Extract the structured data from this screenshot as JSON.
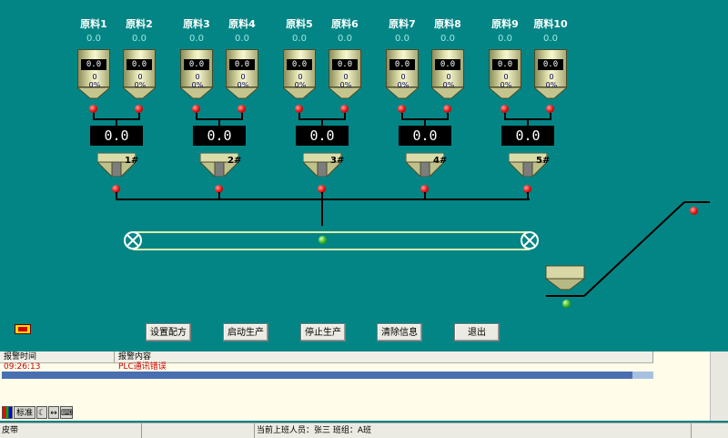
{
  "materials": [
    {
      "name": "原料1",
      "value": "0.0",
      "display": "0.0",
      "count": "0",
      "percent": "0%"
    },
    {
      "name": "原料2",
      "value": "0.0",
      "display": "0.0",
      "count": "0",
      "percent": "0%"
    },
    {
      "name": "原料3",
      "value": "0.0",
      "display": "0.0",
      "count": "0",
      "percent": "0%"
    },
    {
      "name": "原料4",
      "value": "0.0",
      "display": "0.0",
      "count": "0",
      "percent": "0%"
    },
    {
      "name": "原料5",
      "value": "0.0",
      "display": "0.0",
      "count": "0",
      "percent": "0%"
    },
    {
      "name": "原料6",
      "value": "0.0",
      "display": "0.0",
      "count": "0",
      "percent": "0%"
    },
    {
      "name": "原料7",
      "value": "0.0",
      "display": "0.0",
      "count": "0",
      "percent": "0%"
    },
    {
      "name": "原料8",
      "value": "0.0",
      "display": "0.0",
      "count": "0",
      "percent": "0%"
    },
    {
      "name": "原料9",
      "value": "0.0",
      "display": "0.0",
      "count": "0",
      "percent": "0%"
    },
    {
      "name": "原料10",
      "value": "0.0",
      "display": "0.0",
      "count": "0",
      "percent": "0%"
    }
  ],
  "scales": [
    {
      "value": "0.0",
      "label": "1#"
    },
    {
      "value": "0.0",
      "label": "2#"
    },
    {
      "value": "0.0",
      "label": "3#"
    },
    {
      "value": "0.0",
      "label": "4#"
    },
    {
      "value": "0.0",
      "label": "5#"
    }
  ],
  "buttons": {
    "set_recipe": "设置配方",
    "start": "启动生产",
    "stop": "停止生产",
    "clear": "清除信息",
    "exit": "退出"
  },
  "alarm": {
    "col_time": "报警时间",
    "col_content": "报警内容",
    "rows": [
      {
        "time": "09:26:13",
        "content": "PLC通讯错误"
      }
    ],
    "tools": [
      "标准"
    ]
  },
  "status": {
    "left": "皮带",
    "operator": "当前上班人员：张三  班组：A班"
  },
  "colors": {
    "background": "#048585",
    "led_red": "#e01010",
    "led_green": "#3db21a",
    "alarm_text": "#d00000"
  }
}
